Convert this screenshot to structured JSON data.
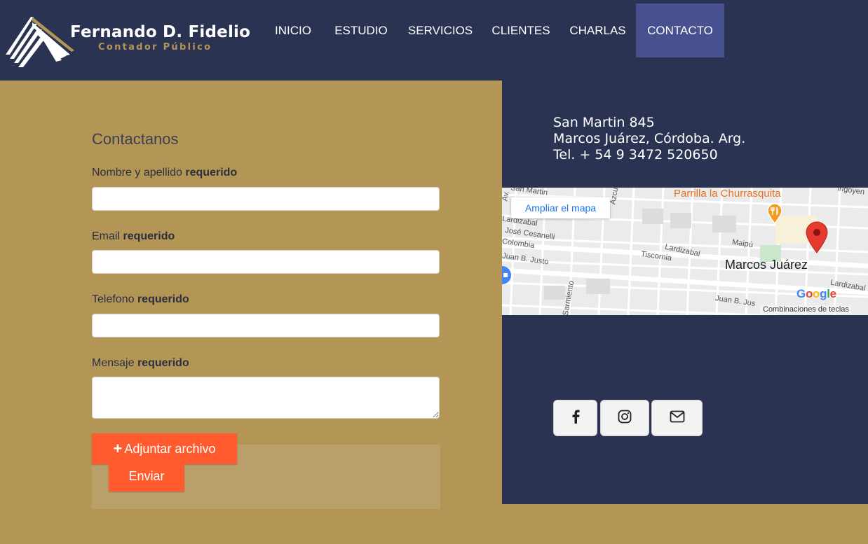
{
  "brand": {
    "name": "Fernando D. Fidelio",
    "subtitle": "Contador Público"
  },
  "nav": {
    "items": [
      {
        "label": "INICIO"
      },
      {
        "label": "ESTUDIO"
      },
      {
        "label": "SERVICIOS"
      },
      {
        "label": "CLIENTES"
      },
      {
        "label": "CHARLAS"
      },
      {
        "label": "CONTACTO",
        "active": true
      }
    ]
  },
  "form": {
    "title": "Contactanos",
    "required_label": "requerido",
    "fields": [
      {
        "label": "Nombre y apellido",
        "value": ""
      },
      {
        "label": "Email",
        "value": ""
      },
      {
        "label": "Telefono",
        "value": ""
      },
      {
        "label": "Mensaje",
        "value": ""
      }
    ],
    "attach_label": "Adjuntar archivo",
    "send_label": "Enviar"
  },
  "contact": {
    "address": "San Martin 845",
    "city": "Marcos Juárez, Córdoba. Arg.",
    "phone": "Tel. + 54 9 3472 520650"
  },
  "map": {
    "enlarge_label": "Ampliar el mapa",
    "place_label": "Marcos Juárez",
    "poi_label": "Parrilla la Churrasquita",
    "shortcuts_label": "Combinaciones de teclas",
    "google_label": "Google",
    "streets": [
      "San Martin",
      "Lardizabal",
      "José Cesanelli",
      "Colombia",
      "Juan B. Justo",
      "Tiscornia",
      "Lardizabal",
      "Maipú",
      "Irigoyen",
      "Lardizabal",
      "Juan B. Jus",
      "Sarmiento",
      "Azcu",
      "Av."
    ]
  },
  "social": {
    "icons": [
      "facebook-icon",
      "instagram-icon",
      "mail-icon"
    ]
  },
  "colors": {
    "header_bg": "#2b3353",
    "nav_active": "#475190",
    "page_bg": "#b39655",
    "accent_button": "#ff5b2e",
    "map_link": "#1a73e8"
  }
}
